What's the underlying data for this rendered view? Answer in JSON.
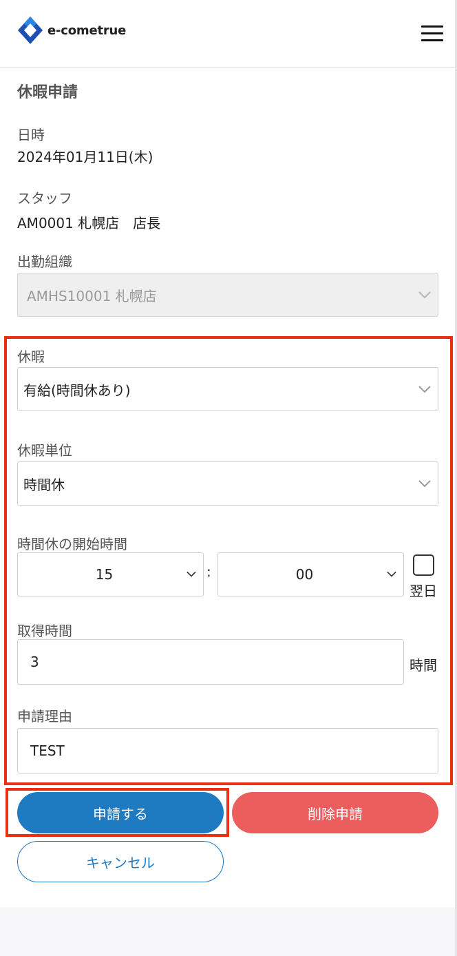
{
  "header": {
    "logo_text": "e-cometrue",
    "menu_icon": "hamburger-menu-icon",
    "logo_colors": [
      "#1e4fb4",
      "#2b8ae6"
    ]
  },
  "page": {
    "title": "休暇申請"
  },
  "info": {
    "datetime_label": "日時",
    "datetime_value": "2024年01月11日(木)",
    "staff_label": "スタッフ",
    "staff_value": "AM0001 札幌店　店長",
    "org_label": "出勤組織",
    "org_value": "AMHS10001 札幌店"
  },
  "form": {
    "leave_label": "休暇",
    "leave_value": "有給(時間休あり)",
    "unit_label": "休暇単位",
    "unit_value": "時間休",
    "start_label": "時間休の開始時間",
    "start_hour": "15",
    "start_minute": "00",
    "time_separator": ":",
    "next_day_label": "翌日",
    "next_day_checked": false,
    "hours_label": "取得時間",
    "hours_value": "3",
    "hours_unit": "時間",
    "reason_label": "申請理由",
    "reason_value": "TEST"
  },
  "actions": {
    "submit_label": "申請する",
    "delete_label": "削除申請",
    "cancel_label": "キャンセル"
  },
  "colors": {
    "primary": "#1e7bc2",
    "danger": "#ec5d5d",
    "highlight": "#ec2f12"
  }
}
